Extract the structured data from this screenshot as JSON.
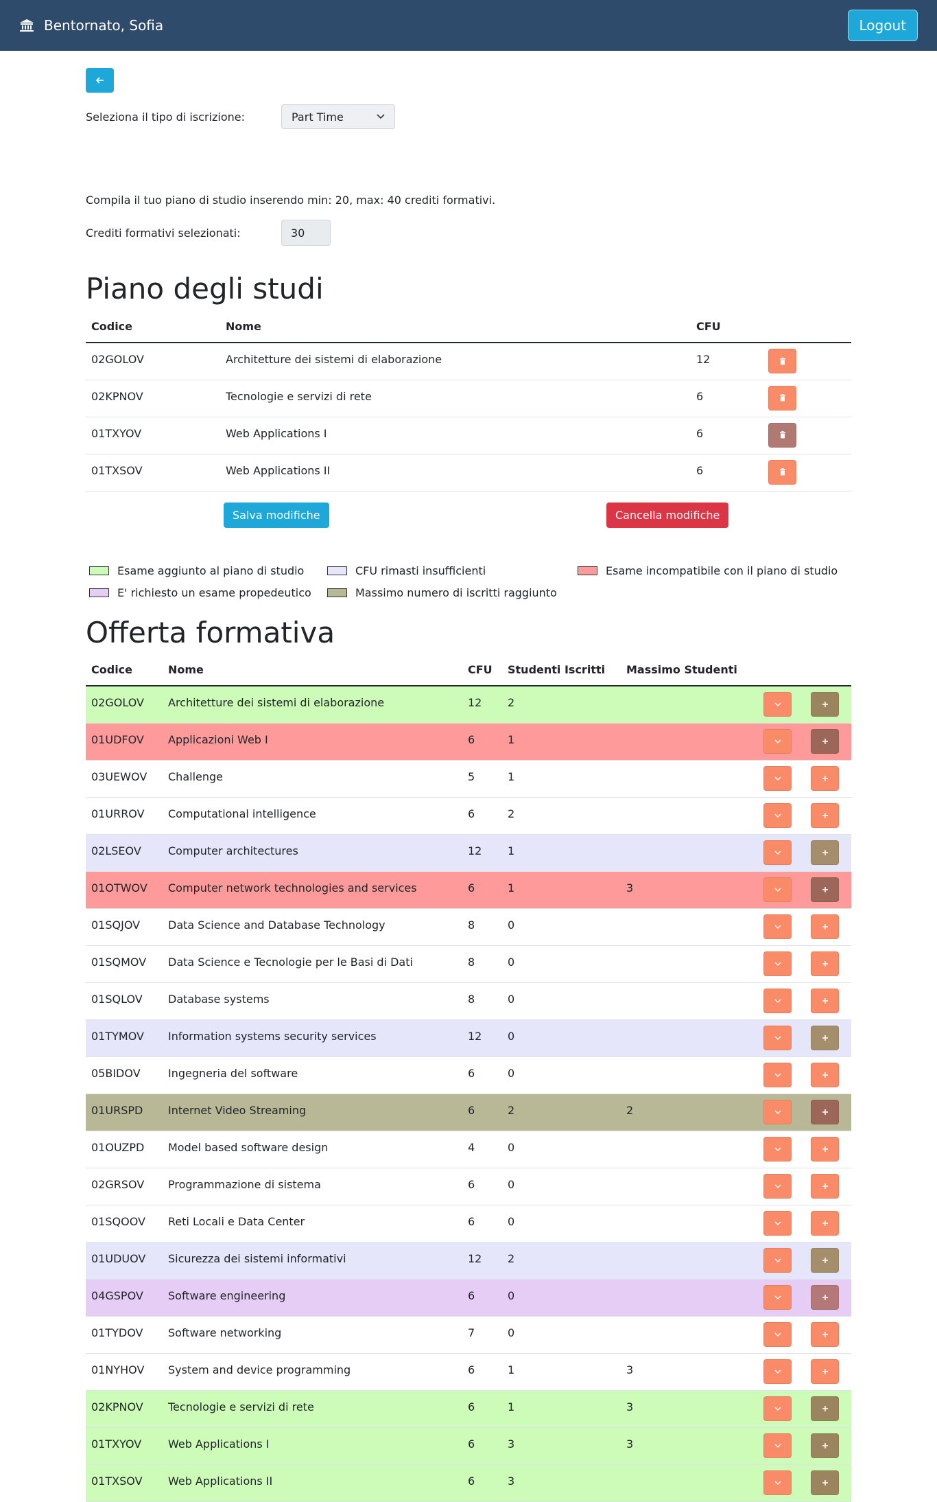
{
  "header": {
    "greeting": "Bentornato, Sofia",
    "logout_label": "Logout"
  },
  "form": {
    "enrollment_label": "Seleziona il tipo di iscrizione:",
    "enrollment_value": "Part Time",
    "instructions": "Compila il tuo piano di studio inserendo min: 20, max: 40 crediti formativi.",
    "credits_label": "Crediti formativi selezionati:",
    "credits_value": "30"
  },
  "plan": {
    "title": "Piano degli studi",
    "headers": {
      "code": "Codice",
      "name": "Nome",
      "cfu": "CFU"
    },
    "rows": [
      {
        "code": "02GOLOV",
        "name": "Architetture dei sistemi di elaborazione",
        "cfu": "12",
        "delete_state": "enabled"
      },
      {
        "code": "02KPNOV",
        "name": "Tecnologie e servizi di rete",
        "cfu": "6",
        "delete_state": "enabled"
      },
      {
        "code": "01TXYOV",
        "name": "Web Applications I",
        "cfu": "6",
        "delete_state": "disabled"
      },
      {
        "code": "01TXSOV",
        "name": "Web Applications II",
        "cfu": "6",
        "delete_state": "enabled"
      }
    ],
    "save_label": "Salva modifiche",
    "cancel_label": "Cancella modifiche"
  },
  "legend": [
    {
      "label": "Esame aggiunto al piano di studio",
      "color": "#ccfcb7"
    },
    {
      "label": "CFU rimasti insufficienti",
      "color": "#e6e6fa"
    },
    {
      "label": "Esame incompatibile con il piano di studio",
      "color": "#ff9a9a"
    },
    {
      "label": "E' richiesto un esame propedeutico",
      "color": "#e6cdf6"
    },
    {
      "label": "Massimo numero di iscritti raggiunto",
      "color": "#b8b896"
    }
  ],
  "offer": {
    "title": "Offerta formativa",
    "headers": {
      "code": "Codice",
      "name": "Nome",
      "cfu": "CFU",
      "enrolled": "Studenti Iscritti",
      "max": "Massimo Studenti"
    },
    "rows": [
      {
        "code": "02GOLOV",
        "name": "Architetture dei sistemi di elaborazione",
        "cfu": "12",
        "enrolled": "2",
        "max": "",
        "status": "green"
      },
      {
        "code": "01UDFOV",
        "name": "Applicazioni Web I",
        "cfu": "6",
        "enrolled": "1",
        "max": "",
        "status": "red"
      },
      {
        "code": "03UEWOV",
        "name": "Challenge",
        "cfu": "5",
        "enrolled": "1",
        "max": "",
        "status": "none"
      },
      {
        "code": "01URROV",
        "name": "Computational intelligence",
        "cfu": "6",
        "enrolled": "2",
        "max": "",
        "status": "none"
      },
      {
        "code": "02LSEOV",
        "name": "Computer architectures",
        "cfu": "12",
        "enrolled": "1",
        "max": "",
        "status": "lav"
      },
      {
        "code": "01OTWOV",
        "name": "Computer network technologies and services",
        "cfu": "6",
        "enrolled": "1",
        "max": "3",
        "status": "red"
      },
      {
        "code": "01SQJOV",
        "name": "Data Science and Database Technology",
        "cfu": "8",
        "enrolled": "0",
        "max": "",
        "status": "none"
      },
      {
        "code": "01SQMOV",
        "name": "Data Science e Tecnologie per le Basi di Dati",
        "cfu": "8",
        "enrolled": "0",
        "max": "",
        "status": "none"
      },
      {
        "code": "01SQLOV",
        "name": "Database systems",
        "cfu": "8",
        "enrolled": "0",
        "max": "",
        "status": "none"
      },
      {
        "code": "01TYMOV",
        "name": "Information systems security services",
        "cfu": "12",
        "enrolled": "0",
        "max": "",
        "status": "lav"
      },
      {
        "code": "05BIDOV",
        "name": "Ingegneria del software",
        "cfu": "6",
        "enrolled": "0",
        "max": "",
        "status": "none"
      },
      {
        "code": "01URSPD",
        "name": "Internet Video Streaming",
        "cfu": "6",
        "enrolled": "2",
        "max": "2",
        "status": "olive"
      },
      {
        "code": "01OUZPD",
        "name": "Model based software design",
        "cfu": "4",
        "enrolled": "0",
        "max": "",
        "status": "none"
      },
      {
        "code": "02GRSOV",
        "name": "Programmazione di sistema",
        "cfu": "6",
        "enrolled": "0",
        "max": "",
        "status": "none"
      },
      {
        "code": "01SQOOV",
        "name": "Reti Locali e Data Center",
        "cfu": "6",
        "enrolled": "0",
        "max": "",
        "status": "none"
      },
      {
        "code": "01UDUOV",
        "name": "Sicurezza dei sistemi informativi",
        "cfu": "12",
        "enrolled": "2",
        "max": "",
        "status": "lav"
      },
      {
        "code": "04GSPOV",
        "name": "Software engineering",
        "cfu": "6",
        "enrolled": "0",
        "max": "",
        "status": "purple"
      },
      {
        "code": "01TYDOV",
        "name": "Software networking",
        "cfu": "7",
        "enrolled": "0",
        "max": "",
        "status": "none"
      },
      {
        "code": "01NYHOV",
        "name": "System and device programming",
        "cfu": "6",
        "enrolled": "1",
        "max": "3",
        "status": "none"
      },
      {
        "code": "02KPNOV",
        "name": "Tecnologie e servizi di rete",
        "cfu": "6",
        "enrolled": "1",
        "max": "3",
        "status": "green"
      },
      {
        "code": "01TXYOV",
        "name": "Web Applications I",
        "cfu": "6",
        "enrolled": "3",
        "max": "3",
        "status": "green"
      },
      {
        "code": "01TXSOV",
        "name": "Web Applications II",
        "cfu": "6",
        "enrolled": "3",
        "max": "",
        "status": "green"
      }
    ]
  },
  "icons": {
    "brand": "bank-icon",
    "back": "arrow-left-icon",
    "delete": "trash-icon",
    "expand": "chevron-down-icon",
    "add": "plus-icon"
  }
}
